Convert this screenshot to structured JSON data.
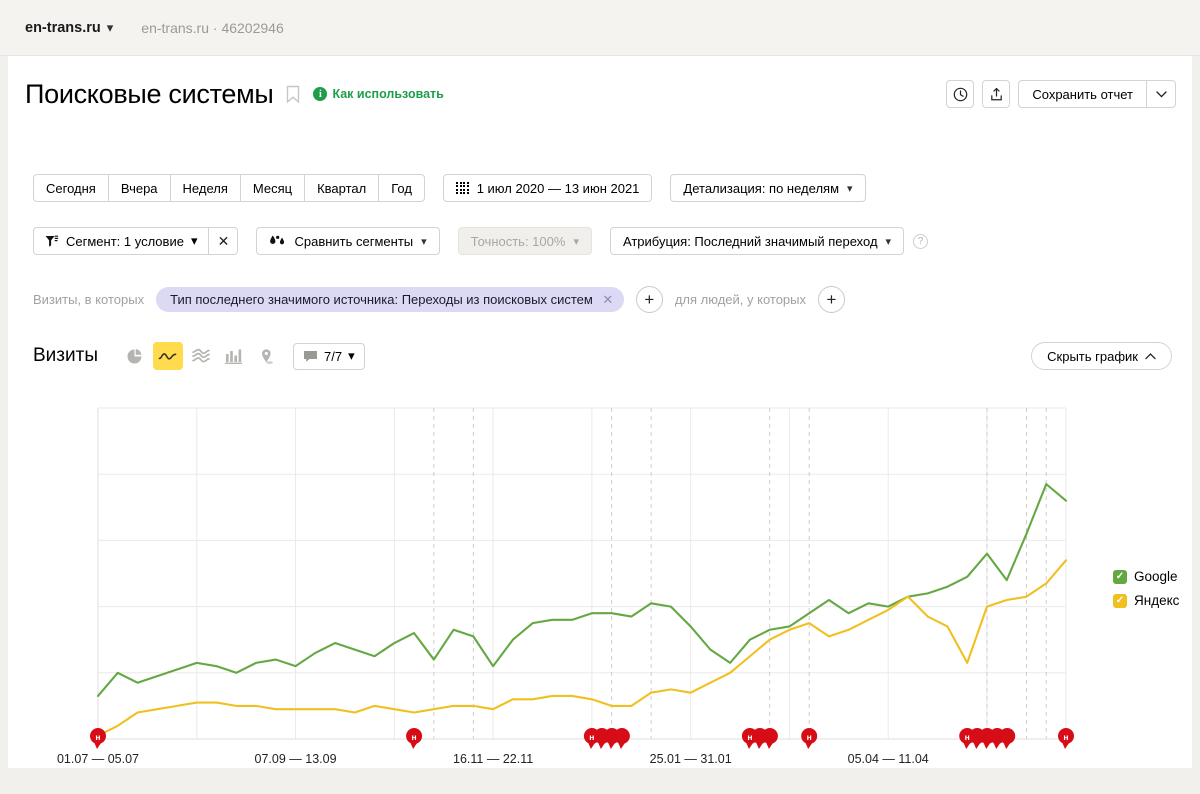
{
  "topbar": {
    "account": "en-trans.ru",
    "account_chevron": "chevron-down-icon",
    "site": "en-trans.ru",
    "separator": "·",
    "counter_id": "46202946"
  },
  "header": {
    "title": "Поисковые системы",
    "bookmark_icon": "bookmark-icon",
    "howto_label": "Как использовать",
    "howto_icon": "info-icon",
    "history_icon": "clock-icon",
    "share_icon": "share-icon",
    "save_label": "Сохранить отчет",
    "save_caret": "chevron-down-icon"
  },
  "period": {
    "quick": [
      "Сегодня",
      "Вчера",
      "Неделя",
      "Месяц",
      "Квартал",
      "Год"
    ],
    "range_icon": "calendar-icon",
    "range": "1 июл 2020 — 13 июн 2021",
    "detail": "Детализация: по неделям"
  },
  "segments": {
    "segment_icon": "funnel-icon",
    "segment_label": "Сегмент: 1 условие",
    "segment_clear": "close-icon",
    "compare_icon": "compare-icon",
    "compare_label": "Сравнить сегменты",
    "accuracy_label": "Точность: 100%",
    "attribution_label": "Атрибуция: Последний значимый переход",
    "help_icon": "question-icon"
  },
  "filter": {
    "prefix": "Визиты, в которых",
    "chip": "Тип последнего значимого источника: Переходы из поисковых систем",
    "chip_remove": "close-icon",
    "add_visit_filter": "+",
    "middle": "для людей, у которых",
    "add_people_filter": "+"
  },
  "charttoolbar": {
    "metric": "Визиты",
    "views": [
      {
        "name": "pie-chart-icon",
        "active": false
      },
      {
        "name": "line-chart-icon",
        "active": true
      },
      {
        "name": "area-chart-icon",
        "active": false
      },
      {
        "name": "bar-chart-icon",
        "active": false
      },
      {
        "name": "map-chart-icon",
        "active": false
      }
    ],
    "comments_icon": "comment-icon",
    "comments_count": "7/7",
    "comments_caret": "chevron-down-icon",
    "hide_chart": "Скрыть график",
    "hide_chart_caret": "chevron-up-icon"
  },
  "colors": {
    "google": "#64a844",
    "yandex": "#f0c020",
    "accent_yellow": "#ffdb4d",
    "marker_red": "#d60d16",
    "chip_bg": "#dcd9f5",
    "link_green": "#1e9e4a"
  },
  "chart_data": {
    "type": "line",
    "title": "Визиты",
    "xlabel": "",
    "ylabel": "",
    "grid": true,
    "legend_position": "right",
    "x_tick_labels": [
      "01.07 — 05.07",
      "07.09 — 13.09",
      "16.11 — 22.11",
      "25.01 — 31.01",
      "05.04 — 11.04"
    ],
    "x_tick_indices": [
      0,
      10,
      20,
      30,
      40
    ],
    "n_points": 50,
    "ylim": [
      0,
      100
    ],
    "y_gridlines": [
      0,
      20,
      40,
      60,
      80,
      100
    ],
    "series": [
      {
        "name": "Google",
        "color": "#64a844",
        "checked": true,
        "values": [
          13,
          20,
          17,
          19,
          21,
          23,
          22,
          20,
          23,
          24,
          22,
          26,
          29,
          27,
          25,
          29,
          32,
          24,
          33,
          31,
          22,
          30,
          35,
          36,
          36,
          38,
          38,
          37,
          41,
          40,
          34,
          27,
          23,
          30,
          33,
          34,
          38,
          42,
          38,
          41,
          40,
          43,
          44,
          46,
          49,
          56,
          48,
          62,
          77,
          72
        ]
      },
      {
        "name": "Яндекс",
        "color": "#f0c020",
        "checked": true,
        "values": [
          1,
          4,
          8,
          9,
          10,
          11,
          11,
          10,
          10,
          9,
          9,
          9,
          9,
          8,
          10,
          9,
          8,
          9,
          10,
          10,
          9,
          12,
          12,
          13,
          13,
          12,
          10,
          10,
          14,
          15,
          14,
          17,
          20,
          25,
          30,
          33,
          35,
          31,
          33,
          36,
          39,
          43,
          37,
          34,
          23,
          40,
          42,
          43,
          47,
          54
        ]
      }
    ],
    "annotations": [
      {
        "x_index": 0,
        "count": 1,
        "glyph": "н"
      },
      {
        "x_index": 16,
        "count": 1,
        "glyph": "н"
      },
      {
        "x_index": 25,
        "count": 4,
        "glyph": "н"
      },
      {
        "x_index": 33,
        "count": 3,
        "glyph": "н"
      },
      {
        "x_index": 36,
        "count": 1,
        "glyph": "н"
      },
      {
        "x_index": 44,
        "count": 5,
        "glyph": "н"
      },
      {
        "x_index": 50,
        "count": 1,
        "glyph": "н"
      }
    ],
    "dashed_vlines": [
      17,
      19,
      26,
      28,
      34,
      36,
      45,
      47,
      48
    ]
  }
}
